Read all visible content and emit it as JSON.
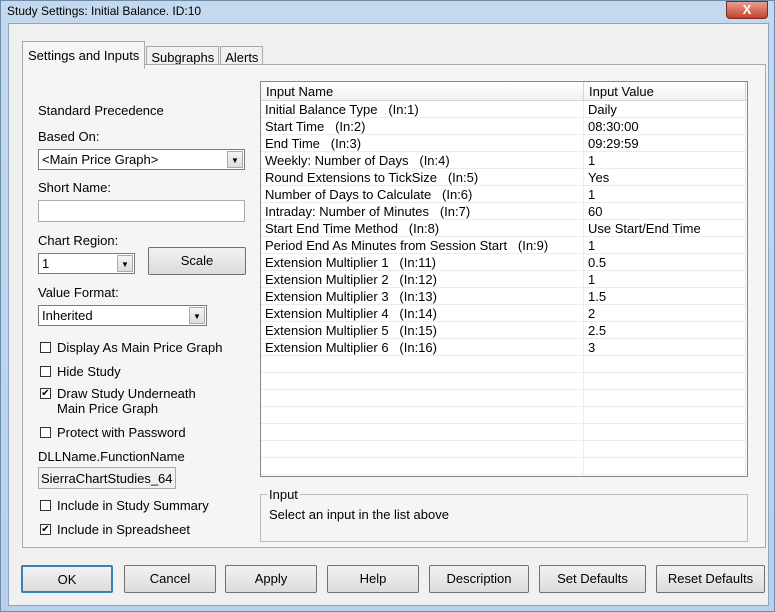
{
  "window": {
    "title": "Study Settings: Initial Balance. ID:10",
    "close": "X"
  },
  "tabs": [
    {
      "label": "Settings and Inputs"
    },
    {
      "label": "Subgraphs"
    },
    {
      "label": "Alerts"
    }
  ],
  "left": {
    "standard_precedence": "Standard Precedence",
    "based_on_label": "Based On:",
    "based_on_value": "<Main Price Graph>",
    "short_name_label": "Short Name:",
    "short_name_value": "",
    "chart_region_label": "Chart Region:",
    "chart_region_value": "1",
    "scale_label": "Scale",
    "value_format_label": "Value Format:",
    "value_format_value": "Inherited",
    "checkboxes": [
      {
        "label": "Display As Main Price Graph",
        "checked": false
      },
      {
        "label": "Hide Study",
        "checked": false
      },
      {
        "label": "Draw Study Underneath",
        "label2": "Main Price Graph",
        "checked": true
      },
      {
        "label": "Protect with Password",
        "checked": false
      }
    ],
    "dll_label": "DLLName.FunctionName",
    "dll_value": "SierraChartStudies_64",
    "checkboxes2": [
      {
        "label": "Include in Study Summary",
        "checked": false
      },
      {
        "label": "Include in Spreadsheet",
        "checked": true
      }
    ]
  },
  "table": {
    "headers": [
      "Input Name",
      "Input Value"
    ],
    "rows": [
      [
        "Initial Balance Type   (In:1)",
        "Daily"
      ],
      [
        "Start Time   (In:2)",
        "08:30:00"
      ],
      [
        "End Time   (In:3)",
        "09:29:59"
      ],
      [
        "Weekly: Number of Days   (In:4)",
        "1"
      ],
      [
        "Round Extensions to TickSize   (In:5)",
        "Yes"
      ],
      [
        "Number of Days to Calculate   (In:6)",
        "1"
      ],
      [
        "Intraday: Number of Minutes   (In:7)",
        "60"
      ],
      [
        "Start End Time Method   (In:8)",
        "Use Start/End Time"
      ],
      [
        "Period End As Minutes from Session Start   (In:9)",
        "1"
      ],
      [
        "Extension Multiplier 1   (In:11)",
        "0.5"
      ],
      [
        "Extension Multiplier 2   (In:12)",
        "1"
      ],
      [
        "Extension Multiplier 3   (In:13)",
        "1.5"
      ],
      [
        "Extension Multiplier 4   (In:14)",
        "2"
      ],
      [
        "Extension Multiplier 5   (In:15)",
        "2.5"
      ],
      [
        "Extension Multiplier 6   (In:16)",
        "3"
      ]
    ]
  },
  "input_group": {
    "caption": "Input",
    "text": "Select an input in the list above"
  },
  "buttons": [
    "OK",
    "Cancel",
    "Apply",
    "Help",
    "Description",
    "Set Defaults",
    "Reset Defaults"
  ]
}
